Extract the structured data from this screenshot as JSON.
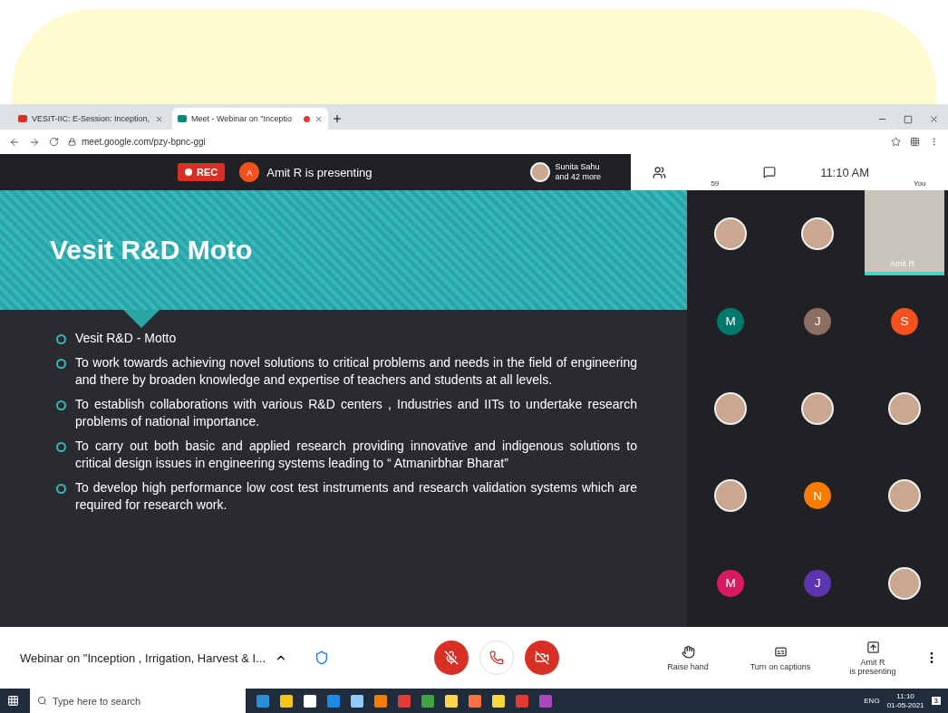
{
  "browser": {
    "tabs": [
      {
        "title": "VESIT-IIC: E-Session: Inception,",
        "selected": false,
        "recording": false
      },
      {
        "title": "Meet - Webinar on \"Inceptio",
        "selected": true,
        "recording": true
      }
    ],
    "url": "meet.google.com/pzy-bpnc-ggi"
  },
  "meet_bar": {
    "rec": "REC",
    "presenter_initial": "A",
    "presenting": "Amit R is presenting",
    "viewer_name": "Sunita Sahu",
    "viewer_more": "and 42 more",
    "people_count": "59",
    "time": "11:10 AM",
    "self_label": "You"
  },
  "slide": {
    "title": "Vesit R&D Moto",
    "bullets": [
      "Vesit R&D - Motto",
      "To work towards achieving novel solutions to critical problems and needs in the field of engineering and there by broaden knowledge and expertise of teachers and students at all levels.",
      "To establish collaborations with various R&D centers , Industries and IITs to undertake research problems of national importance.",
      "To carry out both basic and applied research providing innovative and indigenous solutions to critical design issues in engineering systems leading to “ Atmanirbhar Bharat”",
      "To develop high performance low cost test instruments and research validation systems which are required for research work."
    ]
  },
  "participants": [
    {
      "kind": "photo"
    },
    {
      "kind": "photo"
    },
    {
      "kind": "video",
      "name": "Amit R"
    },
    {
      "kind": "letter",
      "letter": "M",
      "color": "#00796b"
    },
    {
      "kind": "letter",
      "letter": "J",
      "color": "#8d6e63"
    },
    {
      "kind": "letter",
      "letter": "S",
      "color": "#f4511e"
    },
    {
      "kind": "photo"
    },
    {
      "kind": "photo"
    },
    {
      "kind": "photo"
    },
    {
      "kind": "photo"
    },
    {
      "kind": "letter",
      "letter": "N",
      "color": "#f57c00"
    },
    {
      "kind": "photo"
    },
    {
      "kind": "letter",
      "letter": "M",
      "color": "#d81b60"
    },
    {
      "kind": "letter",
      "letter": "J",
      "color": "#5e35b1"
    },
    {
      "kind": "photo"
    }
  ],
  "bottom_bar": {
    "meeting_title": "Webinar on \"Inception , Irrigation, Harvest & I...",
    "mic_on": false,
    "camera_on": false,
    "actions": [
      "Raise hand",
      "Turn on captions",
      "Amit R\nis presenting"
    ]
  },
  "taskbar": {
    "search_placeholder": "Type here to search",
    "language": "ENG",
    "time": "11:10",
    "date": "01-05-2021",
    "notification_count": "3"
  }
}
